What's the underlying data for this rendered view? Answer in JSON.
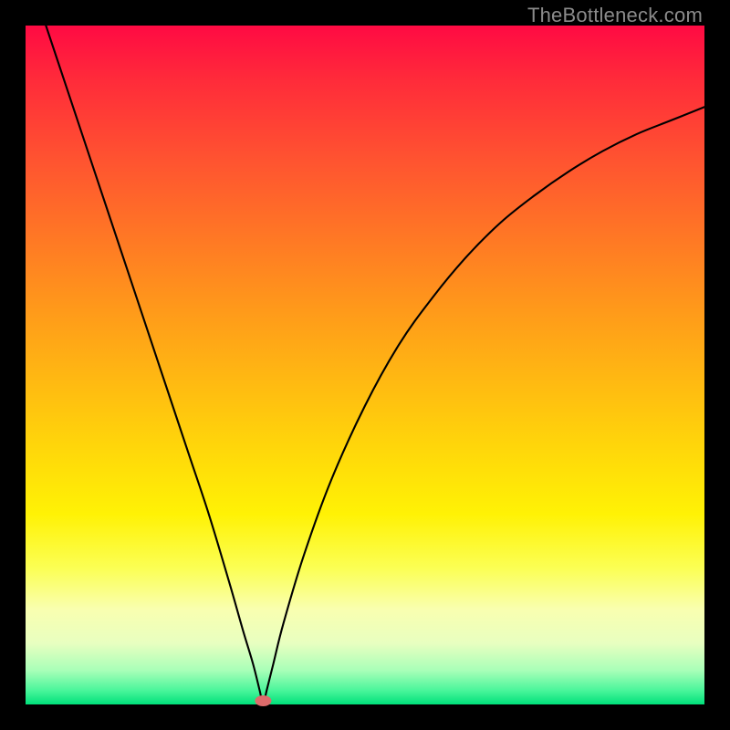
{
  "watermark": "TheBottleneck.com",
  "chart_data": {
    "type": "line",
    "title": "",
    "xlabel": "",
    "ylabel": "",
    "xlim": [
      0,
      100
    ],
    "ylim": [
      0,
      100
    ],
    "minimum_x": 35,
    "marker": {
      "x": 35,
      "y": 0,
      "color": "#dd6b6b"
    },
    "series": [
      {
        "name": "curve",
        "x": [
          3,
          6,
          9,
          12,
          15,
          18,
          21,
          24,
          27,
          30,
          32,
          33.5,
          34.5,
          35,
          35.5,
          36.5,
          38,
          41,
          45,
          50,
          55,
          60,
          65,
          70,
          75,
          80,
          85,
          90,
          95,
          100
        ],
        "y": [
          100,
          91,
          82,
          73,
          64,
          55,
          46,
          37,
          28,
          18,
          11,
          6,
          2,
          0,
          2,
          6,
          12,
          22,
          33,
          44,
          53,
          60,
          66,
          71,
          75,
          78.5,
          81.5,
          84,
          86,
          88
        ]
      }
    ]
  }
}
